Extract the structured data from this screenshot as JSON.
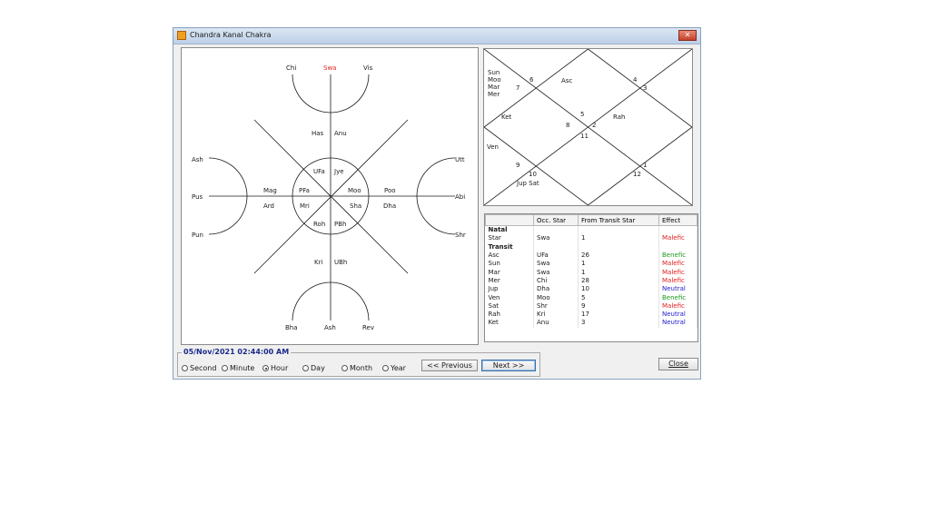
{
  "window": {
    "title": "Chandra Kanal Chakra",
    "close_glyph": "✕"
  },
  "chakra": {
    "top": [
      "Chi",
      "Swa",
      "Vis"
    ],
    "bottom": [
      "Bha",
      "Ash",
      "Rev"
    ],
    "left": [
      "Ash",
      "Pus",
      "Pun"
    ],
    "right": [
      "Utt",
      "Abi",
      "Shr"
    ],
    "highlight_color": "#e02020",
    "inner": [
      "Has",
      "Anu",
      "UFa",
      "Jye",
      "Mag",
      "PFa",
      "Moo",
      "Poo",
      "Ard",
      "Mri",
      "Sha",
      "Dha",
      "Roh",
      "PBh",
      "Kri",
      "UBh"
    ]
  },
  "kundli": {
    "house_numbers": [
      "6",
      "7",
      "4",
      "3",
      "5",
      "8",
      "2",
      "11",
      "9",
      "10",
      "1",
      "12"
    ],
    "planets_top_left": [
      "Sun",
      "Moo",
      "Mar",
      "Mer"
    ],
    "asc": "Asc",
    "ket": "Ket",
    "rah": "Rah",
    "ven": "Ven",
    "jup_sat": "Jup Sat"
  },
  "table": {
    "headers": [
      "",
      "Occ. Star",
      "From Transit Star",
      "Effect"
    ],
    "natal_group": "Natal",
    "natal": [
      {
        "name": "Star",
        "star": "Swa",
        "from": "1",
        "effect": "Malefic",
        "color": "#e02020"
      }
    ],
    "transit_group": "Transit",
    "transit": [
      {
        "name": "Asc",
        "star": "UFa",
        "from": "26",
        "effect": "Benefic",
        "color": "#1a9a1a"
      },
      {
        "name": "Sun",
        "star": "Swa",
        "from": "1",
        "effect": "Malefic",
        "color": "#e02020"
      },
      {
        "name": "Mar",
        "star": "Swa",
        "from": "1",
        "effect": "Malefic",
        "color": "#e02020"
      },
      {
        "name": "Mer",
        "star": "Chi",
        "from": "28",
        "effect": "Malefic",
        "color": "#e02020"
      },
      {
        "name": "Jup",
        "star": "Dha",
        "from": "10",
        "effect": "Neutral",
        "color": "#1a1ad0"
      },
      {
        "name": "Ven",
        "star": "Moo",
        "from": "5",
        "effect": "Benefic",
        "color": "#1a9a1a"
      },
      {
        "name": "Sat",
        "star": "Shr",
        "from": "9",
        "effect": "Malefic",
        "color": "#e02020"
      },
      {
        "name": "Rah",
        "star": "Kri",
        "from": "17",
        "effect": "Neutral",
        "color": "#1a1ad0"
      },
      {
        "name": "Ket",
        "star": "Anu",
        "from": "3",
        "effect": "Neutral",
        "color": "#1a1ad0"
      }
    ]
  },
  "controls": {
    "datetime": "05/Nov/2021 02:44:00 AM",
    "radios": [
      "Second",
      "Minute",
      "Hour",
      "Day",
      "Month",
      "Year"
    ],
    "selected": "Hour",
    "prev_label": "<< Previous",
    "next_label": "Next >>",
    "close_label": "Close"
  }
}
